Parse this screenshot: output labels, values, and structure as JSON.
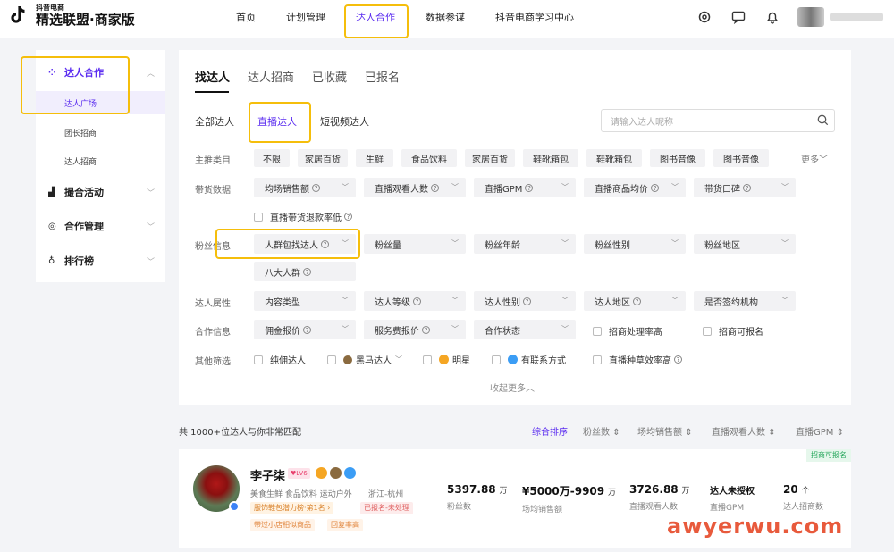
{
  "header": {
    "logo_small": "抖音电商",
    "logo_title": "精选联盟·商家版",
    "nav": [
      "首页",
      "计划管理",
      "达人合作",
      "数据参谋",
      "抖音电商学习中心"
    ],
    "active_nav": 2
  },
  "sidebar": {
    "groups": [
      {
        "label": "达人合作",
        "icon": "grid-icon"
      },
      {
        "label": "撮合活动",
        "icon": "bar-chart-icon"
      },
      {
        "label": "合作管理",
        "icon": "handshake-icon"
      },
      {
        "label": "排行榜",
        "icon": "trophy-icon"
      }
    ],
    "subitems": [
      "达人广场",
      "团长招商",
      "达人招商"
    ]
  },
  "main": {
    "tabs": [
      "找达人",
      "达人招商",
      "已收藏",
      "已报名"
    ],
    "subtabs": [
      "全部达人",
      "直播达人",
      "短视频达人"
    ],
    "search_placeholder": "请输入达人昵称",
    "row_labels": [
      "主推类目",
      "带货数据",
      "粉丝信息",
      "达人属性",
      "合作信息",
      "其他筛选"
    ],
    "categories": [
      "不限",
      "家居百货",
      "生鲜",
      "食品饮料",
      "家居百货",
      "鞋靴箱包",
      "鞋靴箱包",
      "图书音像",
      "图书音像"
    ],
    "more": "更多",
    "sales_selects": [
      "均场销售额",
      "直播观看人数",
      "直播GPM",
      "直播商品均价",
      "带货口碑"
    ],
    "refund_check": "直播带货退款率低",
    "fans_selects": [
      "人群包找达人",
      "粉丝量",
      "粉丝年龄",
      "粉丝性别",
      "粉丝地区"
    ],
    "eight_groups": "八大人群",
    "attr_selects": [
      "内容类型",
      "达人等级",
      "达人性别",
      "达人地区",
      "是否签约机构"
    ],
    "coop_selects": [
      "佣金报价",
      "服务费报价",
      "合作状态"
    ],
    "coop_checks": [
      "招商处理率高",
      "招商可报名"
    ],
    "other_checks": [
      "纯佣达人",
      "黑马达人",
      "明星",
      "有联系方式",
      "直播种草效率高"
    ],
    "collapse": "收起更多"
  },
  "results": {
    "count_text": "共 1000+位达人与你非常匹配",
    "sorts": [
      "综合排序",
      "粉丝数",
      "场均销售额",
      "直播观看人数",
      "直播GPM"
    ]
  },
  "card": {
    "name": "李子柒",
    "level": "♥LV6",
    "categories": "美食生鲜  食品饮料  运动户外",
    "location": "浙江-杭州",
    "rank": "服饰鞋包潜力榜·第1名 ›",
    "registered": "已报名-未处理",
    "tags": [
      "带过小店相似商品",
      "回复率高"
    ],
    "badge": "招商可报名",
    "metrics": [
      {
        "value": "5397.88",
        "unit": "万",
        "label": "粉丝数"
      },
      {
        "value": "¥5000万-9909",
        "unit": "万",
        "label": "场均销售额"
      },
      {
        "value": "3726.88",
        "unit": "万",
        "label": "直播观看人数"
      },
      {
        "value": "达人未授权",
        "unit": "",
        "label": "直播GPM"
      },
      {
        "value": "20",
        "unit": "个",
        "label": "达人招商数"
      }
    ]
  },
  "watermark": "awyerwu.com",
  "colors": {
    "accent": "#5b2df0",
    "highlight": "#f5be0b"
  }
}
